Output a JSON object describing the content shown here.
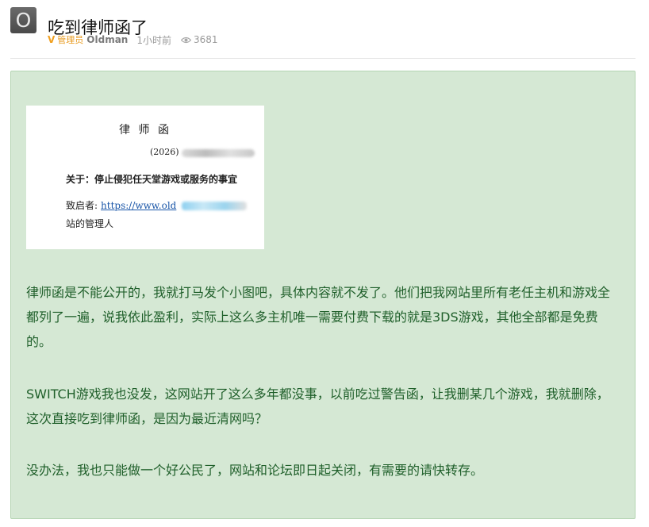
{
  "post": {
    "avatar_letter": "O",
    "title": "吃到律师函了",
    "meta": {
      "badge": "V",
      "role": "管理员",
      "author": "Oldman",
      "time": "1小时前",
      "views": "3681"
    }
  },
  "letter_image": {
    "title": "律 师 函",
    "number": "(2026)",
    "subject": "关于：停止侵犯任天堂游戏或服务的事宜",
    "to_label": "致启者:",
    "to_link": "https://www.old",
    "admin": "站的管理人"
  },
  "paragraphs": [
    "律师函是不能公开的，我就打马发个小图吧，具体内容就不发了。他们把我网站里所有老任主机和游戏全都列了一遍，说我依此盈利，实际上这么多主机唯一需要付费下载的就是3DS游戏，其他全部都是免费的。",
    "SWITCH游戏我也没发，这网站开了这么多年都没事，以前吃过警告函，让我删某几个游戏，我就删除，这次直接吃到律师函，是因为最近清网吗？",
    "没办法，我也只能做一个好公民了，网站和论坛即日起关闭，有需要的请快转存。"
  ],
  "colors": {
    "content_bg": "#d5e8d4",
    "content_text": "#1f5f2a",
    "role_color": "#e89a1e"
  },
  "icons": {
    "views": "eye-icon",
    "badge": "verified-v-icon"
  }
}
